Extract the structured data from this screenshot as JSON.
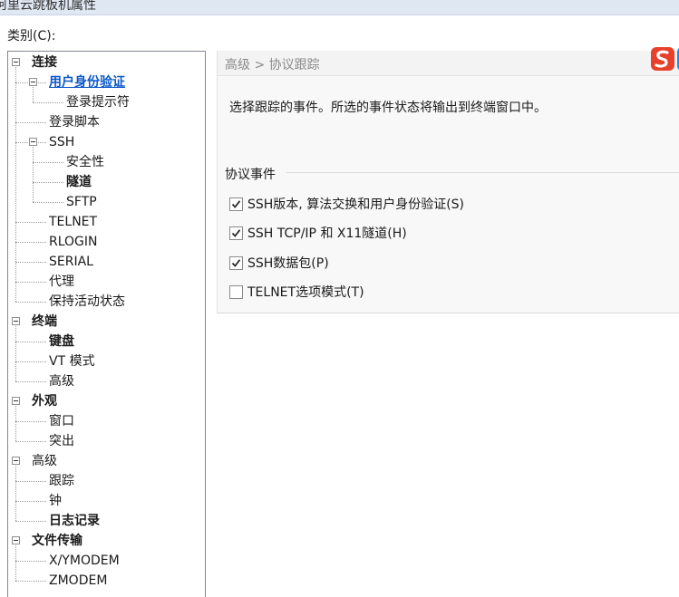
{
  "window": {
    "title": "阿里云跳板机属性"
  },
  "category_label": "类别(C):",
  "tree": {
    "nodes": [
      {
        "id": "connection",
        "label": "连接",
        "level": 0,
        "bold": true,
        "expander": true
      },
      {
        "id": "auth",
        "label": "用户身份验证",
        "level": 1,
        "selected": true,
        "expander": true
      },
      {
        "id": "login-prompt",
        "label": "登录提示符",
        "level": 2
      },
      {
        "id": "login-script",
        "label": "登录脚本",
        "level": 1
      },
      {
        "id": "ssh",
        "label": "SSH",
        "level": 1,
        "expander": true
      },
      {
        "id": "security",
        "label": "安全性",
        "level": 2
      },
      {
        "id": "tunnel",
        "label": "隧道",
        "level": 2,
        "bold": true
      },
      {
        "id": "sftp",
        "label": "SFTP",
        "level": 2
      },
      {
        "id": "telnet",
        "label": "TELNET",
        "level": 1
      },
      {
        "id": "rlogin",
        "label": "RLOGIN",
        "level": 1
      },
      {
        "id": "serial",
        "label": "SERIAL",
        "level": 1
      },
      {
        "id": "proxy",
        "label": "代理",
        "level": 1
      },
      {
        "id": "keepalive",
        "label": "保持活动状态",
        "level": 1
      },
      {
        "id": "terminal",
        "label": "终端",
        "level": 0,
        "bold": true,
        "expander": true
      },
      {
        "id": "keyboard",
        "label": "键盘",
        "level": 1,
        "bold": true
      },
      {
        "id": "vt-mode",
        "label": "VT 模式",
        "level": 1
      },
      {
        "id": "terminal-advanced",
        "label": "高级",
        "level": 1
      },
      {
        "id": "appearance",
        "label": "外观",
        "level": 0,
        "bold": true,
        "expander": true
      },
      {
        "id": "window",
        "label": "窗口",
        "level": 1
      },
      {
        "id": "highlight",
        "label": "突出",
        "level": 1
      },
      {
        "id": "advanced",
        "label": "高级",
        "level": 0,
        "expander": true
      },
      {
        "id": "trace",
        "label": "跟踪",
        "level": 1
      },
      {
        "id": "bell",
        "label": "钟",
        "level": 1
      },
      {
        "id": "logging",
        "label": "日志记录",
        "level": 1,
        "bold": true
      },
      {
        "id": "file-transfer",
        "label": "文件传输",
        "level": 0,
        "bold": true,
        "expander": true
      },
      {
        "id": "xymodem",
        "label": "X/YMODEM",
        "level": 1
      },
      {
        "id": "zmodem",
        "label": "ZMODEM",
        "level": 1
      }
    ]
  },
  "panel": {
    "breadcrumb": "高级 > 协议跟踪",
    "description": "选择跟踪的事件。所选的事件状态将输出到终端窗口中。",
    "group_label": "协议事件",
    "ime_icon": "sogou-ime-icon",
    "checkboxes": [
      {
        "id": "ssh-version",
        "label": "SSH版本, 算法交换和用户身份验证(S)",
        "checked": true
      },
      {
        "id": "ssh-tcpip",
        "label": "SSH TCP/IP 和 X11隧道(H)",
        "checked": true
      },
      {
        "id": "ssh-packets",
        "label": "SSH数据包(P)",
        "checked": true
      },
      {
        "id": "telnet-options",
        "label": "TELNET选项模式(T)",
        "checked": false
      }
    ]
  },
  "colors": {
    "selected_text": "#0b57c9",
    "ime_red": "#e8412b"
  }
}
